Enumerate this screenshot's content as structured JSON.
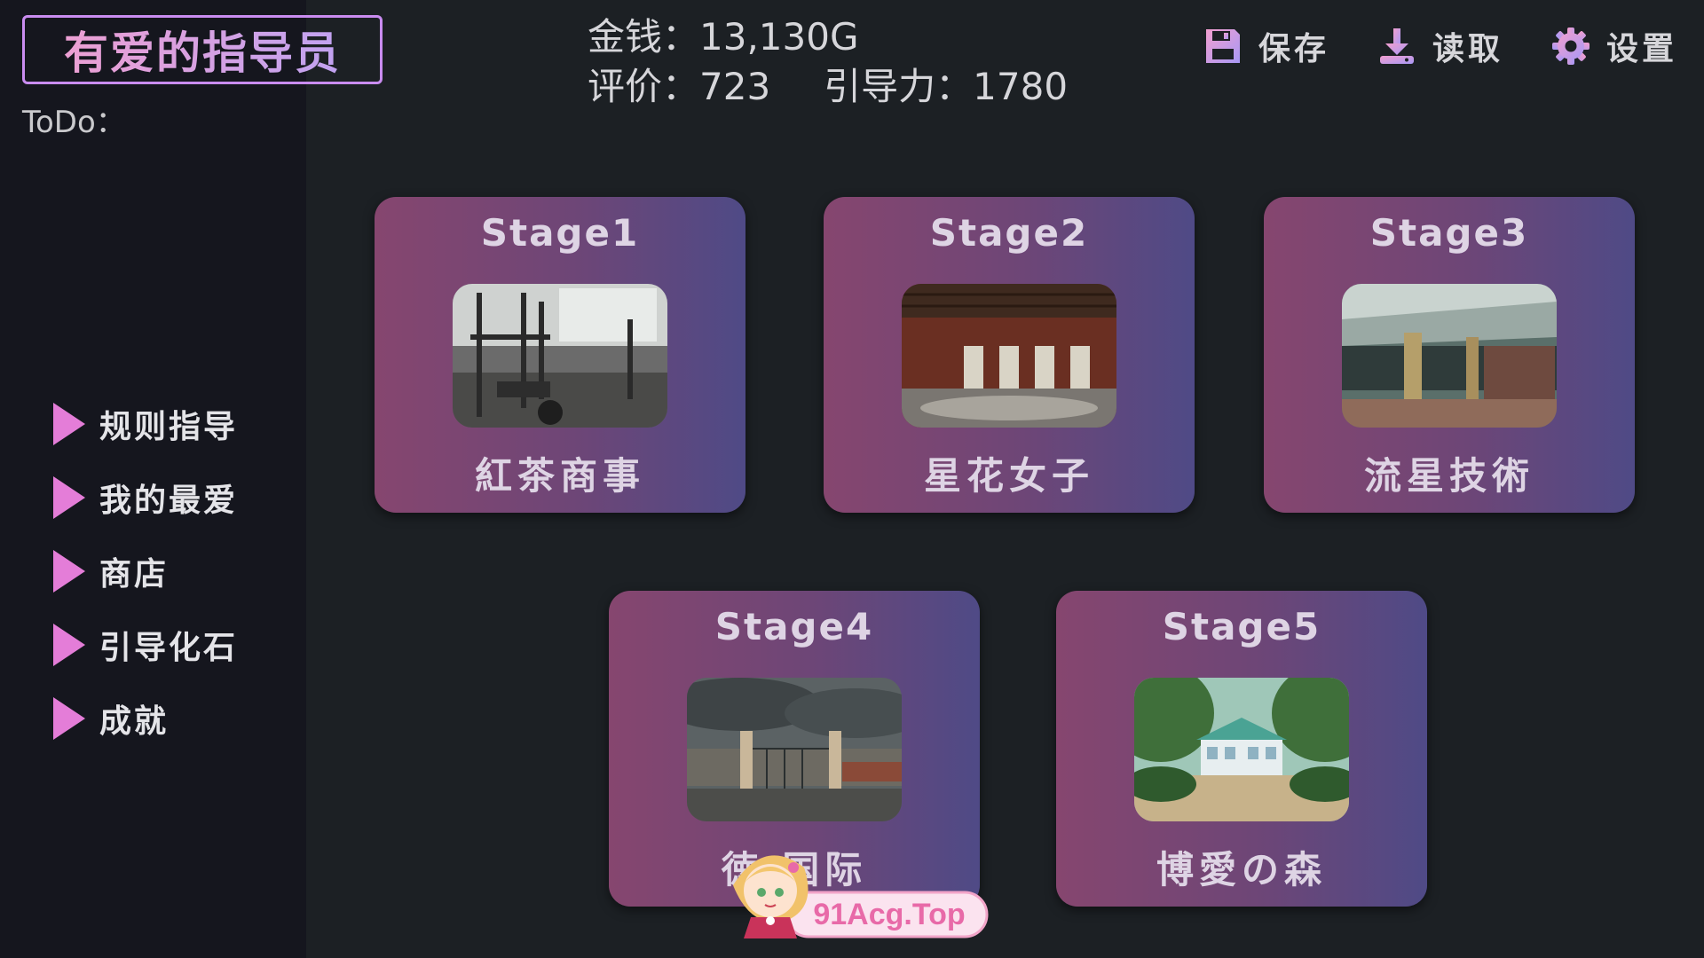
{
  "game_title": "有爱的指导员",
  "todo_label": "ToDo：",
  "sidebar": {
    "items": [
      {
        "label": "规则指导"
      },
      {
        "label": "我的最爱"
      },
      {
        "label": "商店"
      },
      {
        "label": "引导化石"
      },
      {
        "label": "成就"
      }
    ]
  },
  "stats": {
    "money": "金钱：13,130G",
    "rating": "评价：723",
    "guidance": "引导力：1780"
  },
  "top_actions": {
    "save": {
      "label": "保存",
      "icon": "save-icon"
    },
    "load": {
      "label": "读取",
      "icon": "download-icon"
    },
    "settings": {
      "label": "设置",
      "icon": "gear-icon"
    }
  },
  "stages": [
    {
      "name": "Stage1",
      "place": "紅茶商事",
      "thumb": "gym-photo"
    },
    {
      "name": "Stage2",
      "place": "星花女子",
      "thumb": "brick-hall-photo"
    },
    {
      "name": "Stage3",
      "place": "流星技術",
      "thumb": "building-entrance-photo"
    },
    {
      "name": "Stage4",
      "place": "徳 国际",
      "thumb": "gate-cloudy-photo"
    },
    {
      "name": "Stage5",
      "place": "博愛の森",
      "thumb": "forest-building-photo"
    }
  ],
  "watermark": {
    "text": "91Acg.Top"
  },
  "colors": {
    "accent_pink": "#e47dd8",
    "icon_gradient_start": "#f29fcf",
    "icon_gradient_end": "#a898f5",
    "card_left": "#86466f",
    "card_right": "#4f4a86",
    "sidebar_bg": "#15161e",
    "main_bg": "#1c2024"
  }
}
